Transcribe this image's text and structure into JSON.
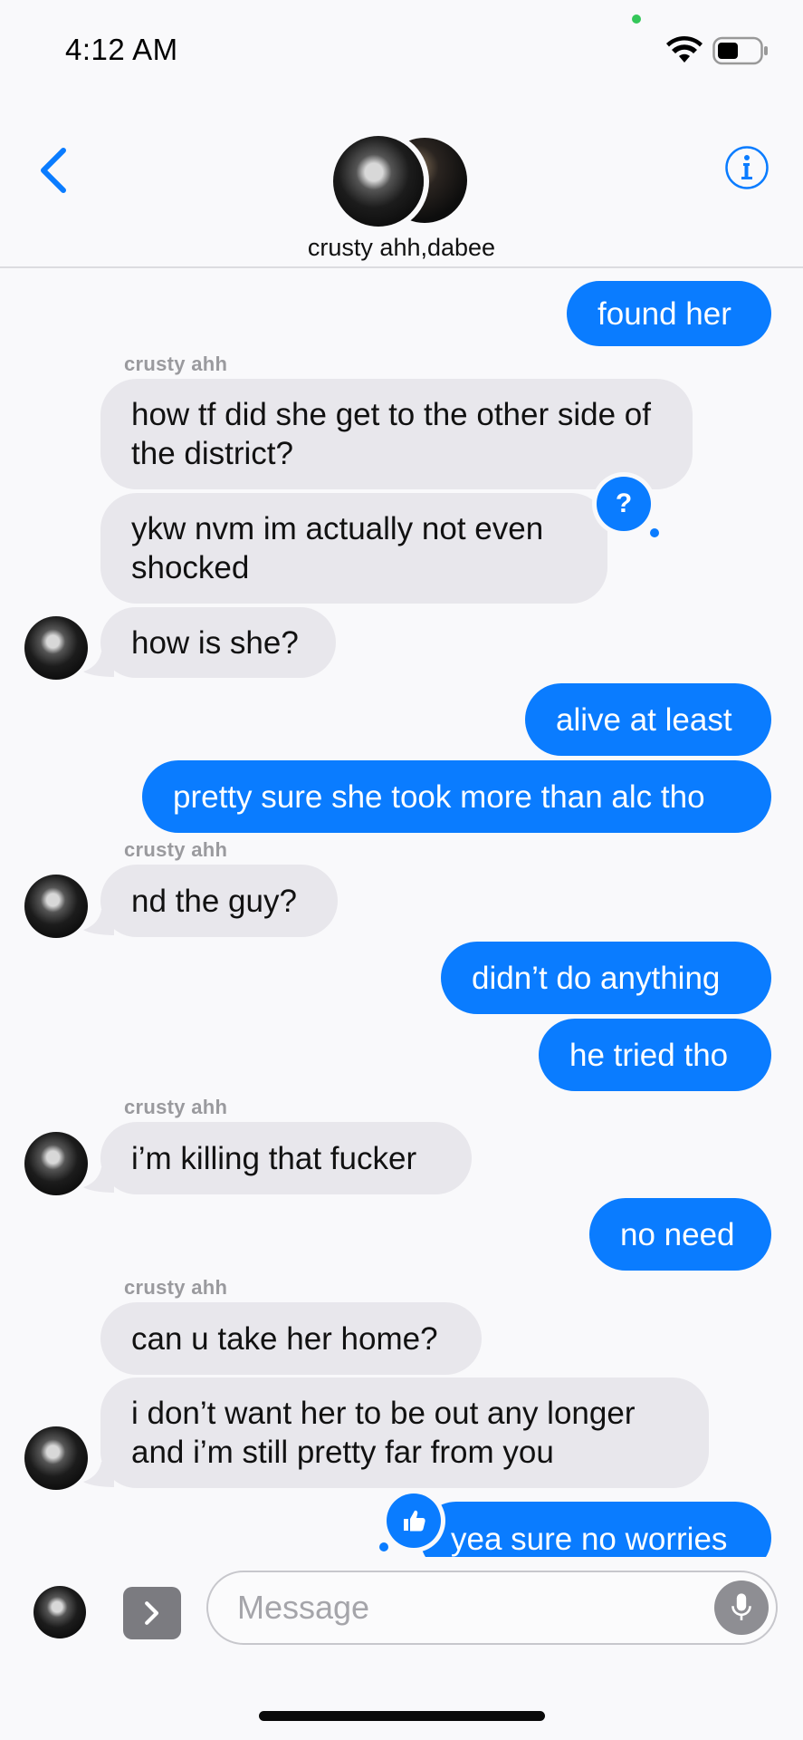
{
  "status_bar": {
    "time": "4:12 AM"
  },
  "header": {
    "group_name": "crusty ahh,dabee"
  },
  "messages": [
    {
      "text": "found her"
    },
    {
      "sender": "crusty ahh",
      "text": "how tf did she get to the other side of the district?"
    },
    {
      "text": "ykw nvm im actually not even shocked",
      "reaction": "?"
    },
    {
      "text": "how is she?"
    },
    {
      "text": "alive at least"
    },
    {
      "text": "pretty sure she took more than alc tho"
    },
    {
      "sender": "crusty ahh",
      "text": "nd the guy?"
    },
    {
      "text": "didn’t do anything"
    },
    {
      "text": "he tried tho"
    },
    {
      "sender": "crusty ahh",
      "text": "i’m killing that fucker"
    },
    {
      "text": "no need"
    },
    {
      "sender": "crusty ahh",
      "text": "can u take her home?"
    },
    {
      "text": "i don’t want her to be out any longer and i’m still pretty far from you"
    },
    {
      "text": "yea sure no worries",
      "reaction": "thumbs-up"
    }
  ],
  "composer": {
    "placeholder": "Message"
  },
  "colors": {
    "accent": "#0a7cff",
    "incoming_bubble": "#e8e7ec"
  }
}
